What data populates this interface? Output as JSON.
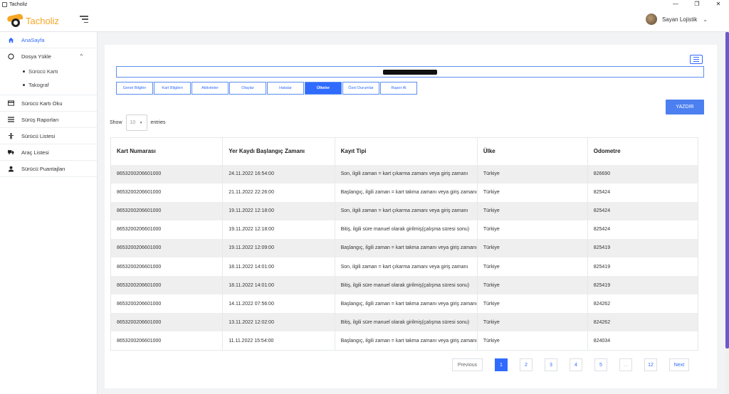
{
  "window": {
    "title": "Tacholiz",
    "controls": [
      "—",
      "❐",
      "✕"
    ]
  },
  "header": {
    "brand": "Tacholiz",
    "user_name": "Sayan Lojistik"
  },
  "sidebar": {
    "items": [
      {
        "label": "AnaSayfa",
        "icon": "home-icon",
        "active": true
      },
      {
        "label": "Dosya Yükle",
        "icon": "circle-icon"
      },
      {
        "label": "Sürücü Kartı Oku",
        "icon": "card-icon"
      },
      {
        "label": "Sürüş Raporları",
        "icon": "list-icon"
      },
      {
        "label": "Sürücü Listesi",
        "icon": "person-icon"
      },
      {
        "label": "Araç Listesi",
        "icon": "truck-icon"
      },
      {
        "label": "Sürücü Puantajları",
        "icon": "user-icon"
      }
    ],
    "sub_items": [
      "Sürücü Kartı",
      "Takograf"
    ]
  },
  "main": {
    "driver_name_redacted": "████████",
    "tabs": [
      "Genel Bilgiler",
      "Kart Bilgileri",
      "Aktiviteler",
      "Olaylar",
      "Hatalar",
      "Ülkeler",
      "Özel Durumlar",
      "Rapor Al"
    ],
    "active_tab": 5,
    "print_label": "YAZDIR",
    "show_label": "Show",
    "entries_label": "entries",
    "page_size": "10"
  },
  "table": {
    "columns": [
      "Kart Numarası",
      "Yer Kaydı Başlangıç Zamanı",
      "Kayıt Tipi",
      "Ülke",
      "Odometre"
    ],
    "rows": [
      [
        "8653200206601000",
        "24.11.2022 16:54:00",
        "Son, ilgili zaman = kart çıkarma zamanı veya giriş zamanı",
        "Türkiye",
        "826690"
      ],
      [
        "8653200206601000",
        "21.11.2022 22:26:00",
        "Başlangıç, ilgili zaman = kart takma zamanı veya giriş zamanı",
        "Türkiye",
        "825424"
      ],
      [
        "8653200206601000",
        "19.11.2022 12:18:00",
        "Son, ilgili zaman = kart çıkarma zamanı veya giriş zamanı",
        "Türkiye",
        "825424"
      ],
      [
        "8653200206601000",
        "19.11.2022 12:18:00",
        "Bitiş, ilgili süre manuel olarak girilmiş(çalışma süresi sonu)",
        "Türkiye",
        "825424"
      ],
      [
        "8653200206601000",
        "19.11.2022 12:09:00",
        "Başlangıç, ilgili zaman = kart takma zamanı veya giriş zamanı",
        "Türkiye",
        "825419"
      ],
      [
        "8653200206601000",
        "18.11.2022 14:01:00",
        "Son, ilgili zaman = kart çıkarma zamanı veya giriş zamanı",
        "Türkiye",
        "825419"
      ],
      [
        "8653200206601000",
        "18.11.2022 14:01:00",
        "Bitiş, ilgili süre manuel olarak girilmiş(çalışma süresi sonu)",
        "Türkiye",
        "825419"
      ],
      [
        "8653200206601000",
        "14.11.2022 07:56:00",
        "Başlangıç, ilgili zaman = kart takma zamanı veya giriş zamanı",
        "Türkiye",
        "824262"
      ],
      [
        "8653200206601000",
        "13.11.2022 12:02:00",
        "Bitiş, ilgili süre manuel olarak girilmiş(çalışma süresi sonu)",
        "Türkiye",
        "824262"
      ],
      [
        "8653200206601000",
        "11.11.2022 15:54:00",
        "Başlangıç, ilgili zaman = kart takma zamanı veya giriş zamanı",
        "Türkiye",
        "824034"
      ]
    ]
  },
  "pagination": {
    "previous": "Previous",
    "next": "Next",
    "pages": [
      "1",
      "2",
      "3",
      "4",
      "5",
      "…",
      "12"
    ],
    "current": "1"
  },
  "colors": {
    "accent": "#2f6bff",
    "brand": "#f5a623",
    "scroll_thumb": "#6a5acd"
  }
}
